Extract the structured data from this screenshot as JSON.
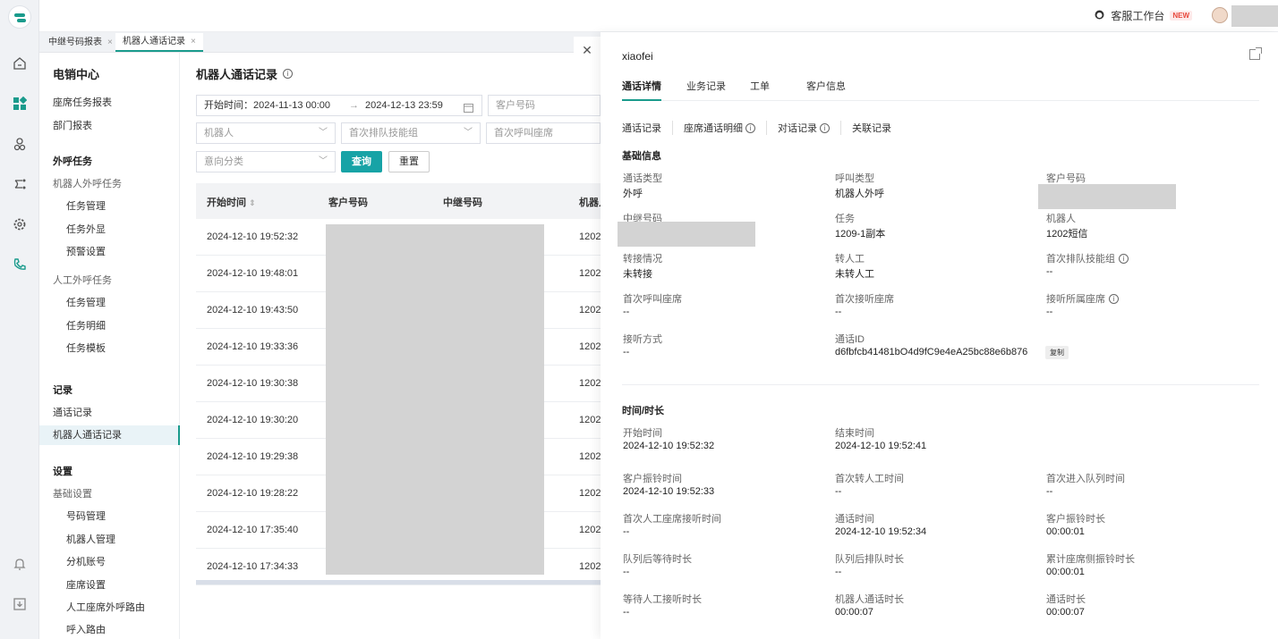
{
  "topbar": {
    "workspace_label": "客服工作台",
    "new_badge": "NEW"
  },
  "tabs": [
    {
      "label": "中继号码报表",
      "close": "×"
    },
    {
      "label": "机器人通话记录",
      "close": "×"
    }
  ],
  "sidebar": {
    "title": "电销中心",
    "items": [
      "座席任务报表",
      "部门报表",
      "外呼任务",
      "机器人外呼任务",
      "任务管理",
      "任务外显",
      "预警设置",
      "人工外呼任务",
      "任务管理",
      "任务明细",
      "任务模板",
      "记录",
      "通话记录",
      "机器人通话记录",
      "设置",
      "基础设置",
      "号码管理",
      "机器人管理",
      "分机账号",
      "座席设置",
      "人工座席外呼路由",
      "呼入路由"
    ]
  },
  "main": {
    "title": "机器人通话记录",
    "filters": {
      "date_label": "开始时间：",
      "date_start": "2024-11-13 00:00",
      "date_arrow": "→",
      "date_end": "2024-12-13 23:59",
      "customer_placeholder": "客户号码",
      "robot_placeholder": "机器人",
      "skill_placeholder": "首次排队技能组",
      "seat_placeholder": "首次呼叫座席",
      "intent_placeholder": "意向分类",
      "query_button": "查询",
      "reset_button": "重置"
    },
    "table": {
      "headers": [
        "开始时间",
        "客户号码",
        "中继号码",
        "机器人"
      ],
      "rows": [
        {
          "time": "2024-12-10 19:52:32",
          "robot": "1202"
        },
        {
          "time": "2024-12-10 19:48:01",
          "robot": "1202"
        },
        {
          "time": "2024-12-10 19:43:50",
          "robot": "1202"
        },
        {
          "time": "2024-12-10 19:33:36",
          "robot": "1202"
        },
        {
          "time": "2024-12-10 19:30:38",
          "robot": "1202"
        },
        {
          "time": "2024-12-10 19:30:20",
          "robot": "1202"
        },
        {
          "time": "2024-12-10 19:29:38",
          "robot": "1202"
        },
        {
          "time": "2024-12-10 19:28:22",
          "robot": "1202"
        },
        {
          "time": "2024-12-10 17:35:40",
          "robot": "1202"
        },
        {
          "time": "2024-12-10 17:34:33",
          "robot": "1202"
        }
      ]
    }
  },
  "drawer": {
    "name": "xiaofei",
    "tabs": [
      "通话详情",
      "业务记录",
      "工单",
      "客户信息"
    ],
    "subtabs": [
      "通话记录",
      "座席通话明细",
      "对话记录",
      "关联记录"
    ],
    "basic_title": "基础信息",
    "basic": [
      {
        "label": "通话类型",
        "value": "外呼"
      },
      {
        "label": "呼叫类型",
        "value": "机器人外呼"
      },
      {
        "label": "客户号码",
        "value": ""
      },
      {
        "label": "中继号码",
        "value": ""
      },
      {
        "label": "任务",
        "value": "1209-1副本"
      },
      {
        "label": "机器人",
        "value": "1202短信"
      },
      {
        "label": "转接情况",
        "value": "未转接"
      },
      {
        "label": "转人工",
        "value": "未转人工"
      },
      {
        "label": "首次排队技能组",
        "value": "--"
      },
      {
        "label": "首次呼叫座席",
        "value": "--"
      },
      {
        "label": "首次接听座席",
        "value": "--"
      },
      {
        "label": "接听所属座席",
        "value": "--"
      },
      {
        "label": "接听方式",
        "value": "--"
      },
      {
        "label": "通话ID",
        "value": "d6fbfcb41481bO4d9fC9e4eA25bc88e6b876"
      }
    ],
    "copy_label": "复制",
    "time_title": "时间/时长",
    "time": [
      {
        "label": "开始时间",
        "value": "2024-12-10 19:52:32"
      },
      {
        "label": "结束时间",
        "value": "2024-12-10 19:52:41"
      },
      {
        "label": "客户振铃时间",
        "value": "2024-12-10 19:52:33"
      },
      {
        "label": "首次转人工时间",
        "value": "--"
      },
      {
        "label": "首次进入队列时间",
        "value": "--"
      },
      {
        "label": "首次人工座席接听时间",
        "value": "--"
      },
      {
        "label": "通话时间",
        "value": "2024-12-10 19:52:34"
      },
      {
        "label": "客户振铃时长",
        "value": "00:00:01"
      },
      {
        "label": "队列后等待时长",
        "value": "--"
      },
      {
        "label": "队列后排队时长",
        "value": "--"
      },
      {
        "label": "累计座席侧振铃时长",
        "value": "00:00:01"
      },
      {
        "label": "等待人工接听时长",
        "value": "--"
      },
      {
        "label": "机器人通话时长",
        "value": "00:00:07"
      },
      {
        "label": "通话时长",
        "value": "00:00:07"
      }
    ]
  }
}
